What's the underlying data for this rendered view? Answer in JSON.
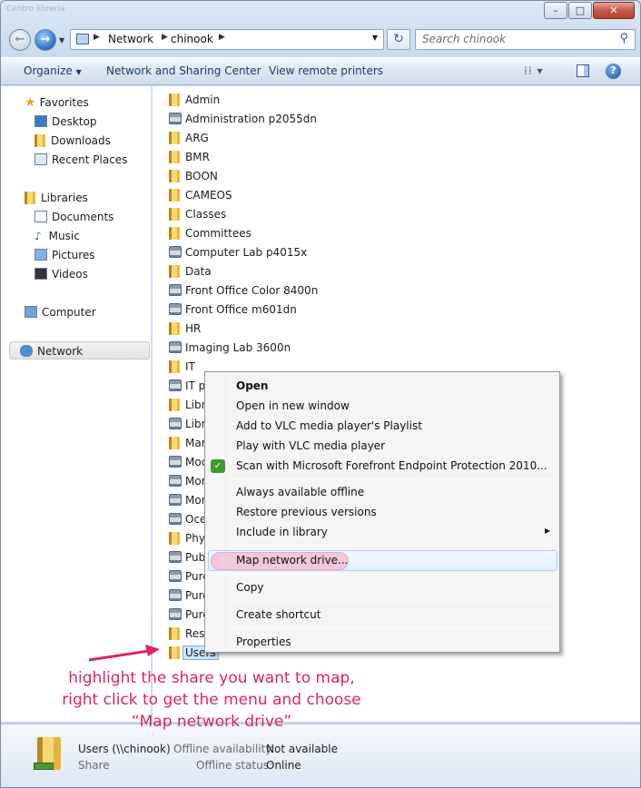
{
  "window": {
    "controls": {
      "minimize": "–",
      "maximize": "□",
      "close": "✕"
    },
    "ghost_titles": [
      "Centro libreria"
    ]
  },
  "address": {
    "crumbs": [
      "Network",
      "chinook"
    ],
    "search_placeholder": "Search chinook",
    "refresh_icon": "refresh-icon",
    "search_icon": "magnifier-icon"
  },
  "toolbar": {
    "organize": "Organize",
    "network_sharing": "Network and Sharing Center",
    "view_printers": "View remote printers",
    "help": "?"
  },
  "navpane": {
    "favorites": "Favorites",
    "desktop": "Desktop",
    "downloads": "Downloads",
    "recent": "Recent Places",
    "libraries": "Libraries",
    "documents": "Documents",
    "music": "Music",
    "pictures": "Pictures",
    "videos": "Videos",
    "computer": "Computer",
    "network": "Network"
  },
  "files": [
    {
      "name": "Admin",
      "type": "folder"
    },
    {
      "name": "Administration p2055dn",
      "type": "printer"
    },
    {
      "name": "ARG",
      "type": "folder"
    },
    {
      "name": "BMR",
      "type": "folder"
    },
    {
      "name": "BOON",
      "type": "folder"
    },
    {
      "name": "CAMEOS",
      "type": "folder"
    },
    {
      "name": "Classes",
      "type": "folder"
    },
    {
      "name": "Committees",
      "type": "folder"
    },
    {
      "name": "Computer Lab p4015x",
      "type": "printer"
    },
    {
      "name": "Data",
      "type": "folder"
    },
    {
      "name": "Front Office Color 8400n",
      "type": "printer"
    },
    {
      "name": "Front Office m601dn",
      "type": "printer"
    },
    {
      "name": "HR",
      "type": "folder"
    },
    {
      "name": "Imaging Lab 3600n",
      "type": "printer"
    },
    {
      "name": "IT",
      "type": "folder"
    },
    {
      "name": "IT p",
      "type": "printer"
    },
    {
      "name": "Libr",
      "type": "folder"
    },
    {
      "name": "Libr",
      "type": "printer"
    },
    {
      "name": "Mar",
      "type": "folder"
    },
    {
      "name": "Moc",
      "type": "printer"
    },
    {
      "name": "Mor",
      "type": "printer"
    },
    {
      "name": "Mor",
      "type": "printer"
    },
    {
      "name": "Oce",
      "type": "printer"
    },
    {
      "name": "Phy",
      "type": "folder"
    },
    {
      "name": "Pub",
      "type": "printer"
    },
    {
      "name": "Purc",
      "type": "printer"
    },
    {
      "name": "Purc",
      "type": "printer"
    },
    {
      "name": "Purc",
      "type": "printer"
    },
    {
      "name": "Rese",
      "type": "folder"
    },
    {
      "name": "Users",
      "type": "folder",
      "selected": true
    }
  ],
  "context_menu": {
    "open": "Open",
    "open_new_window": "Open in new window",
    "add_vlc_playlist": "Add to VLC media player's Playlist",
    "play_vlc": "Play with VLC media player",
    "scan_forefront": "Scan with Microsoft Forefront Endpoint Protection 2010...",
    "always_offline": "Always available offline",
    "restore_versions": "Restore previous versions",
    "include_library": "Include in library",
    "map_drive": "Map network drive...",
    "copy": "Copy",
    "create_shortcut": "Create shortcut",
    "properties": "Properties"
  },
  "annotation": {
    "line1": "highlight the share you want to map,",
    "line2": "right click to get the menu and choose",
    "line3": "“Map network drive”",
    "color": "#e0245e"
  },
  "details": {
    "name": "Users (\\\\chinook)",
    "type": "Share",
    "offline_availability_label": "Offline availability:",
    "offline_availability_value": "Not available",
    "offline_status_label": "Offline status:",
    "offline_status_value": "Online"
  }
}
